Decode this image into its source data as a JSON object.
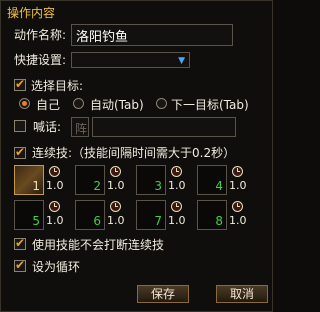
{
  "title": "操作内容",
  "action_name_label": "动作名称:",
  "action_name_value": "洛阳钓鱼",
  "hotkey_label": "快捷设置:",
  "hotkey_value": "",
  "select_target": {
    "label": "选择目标:",
    "checked": true
  },
  "target_options": [
    {
      "label": "自己",
      "selected": true
    },
    {
      "label": "自动(Tab)",
      "selected": false
    },
    {
      "label": "下一目标(Tab)",
      "selected": false
    }
  ],
  "shout": {
    "label": "喊话:",
    "checked": false,
    "channel": "阵",
    "value": ""
  },
  "combo": {
    "label": "连续技:（技能间隔时间需大于0.2秒）",
    "checked": true
  },
  "slots": [
    {
      "num": "1",
      "delay": "1.0",
      "has_icon": true
    },
    {
      "num": "2",
      "delay": "1.0",
      "has_icon": false
    },
    {
      "num": "3",
      "delay": "1.0",
      "has_icon": false
    },
    {
      "num": "4",
      "delay": "1.0",
      "has_icon": false
    },
    {
      "num": "5",
      "delay": "1.0",
      "has_icon": false
    },
    {
      "num": "6",
      "delay": "1.0",
      "has_icon": false
    },
    {
      "num": "7",
      "delay": "1.0",
      "has_icon": false
    },
    {
      "num": "8",
      "delay": "1.0",
      "has_icon": false
    }
  ],
  "no_interrupt": {
    "label": "使用技能不会打断连续技",
    "checked": true
  },
  "loop": {
    "label": "设为循环",
    "checked": true
  },
  "buttons": {
    "save": "保存",
    "cancel": "取消"
  },
  "colors": {
    "accent": "#f0c040",
    "check": "#f0a020",
    "slot_number": "#40d040"
  }
}
